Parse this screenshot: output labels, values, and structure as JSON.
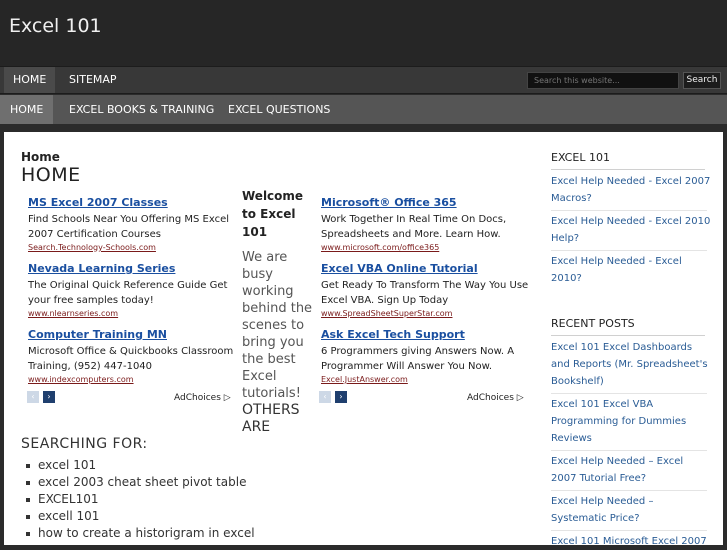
{
  "site": {
    "title": "Excel 101"
  },
  "nav_primary": [
    {
      "label": "HOME"
    },
    {
      "label": "SITEMAP"
    }
  ],
  "search": {
    "placeholder": "Search this website...",
    "button_label": "Search"
  },
  "nav_secondary": [
    {
      "label": "HOME"
    },
    {
      "label": "EXCEL BOOKS & TRAINING"
    },
    {
      "label": "EXCEL QUESTIONS"
    }
  ],
  "main": {
    "breadcrumb": "Home",
    "title": "HOME",
    "welcome_title": "Welcome to Excel 101",
    "welcome_text": "We are busy working behind the scenes to bring you the best Excel tutorials!",
    "others_label": "OTHERS ARE",
    "searching_heading": "SEARCHING FOR:",
    "search_terms": [
      "excel 101",
      "excel 2003 cheat sheet pivot table",
      "EXCEL101",
      "excell 101",
      "how to create a historigram in excel"
    ]
  },
  "ads_left": {
    "items": [
      {
        "title": "MS Excel 2007 Classes",
        "text": "Find Schools Near You Offering MS Excel 2007 Certification Courses",
        "url": "Search.Technology-Schools.com"
      },
      {
        "title": "Nevada Learning Series",
        "text": "The Original Quick Reference Guide Get your free samples today!",
        "url": "www.nlearnseries.com"
      },
      {
        "title": "Computer Training MN",
        "text": "Microsoft Office & Quickbooks Classroom Training, (952) 447-1040",
        "url": "www.indexcomputers.com"
      }
    ],
    "prev": "‹",
    "next": "›",
    "adchoices": "AdChoices ▷"
  },
  "ads_right": {
    "items": [
      {
        "title": "Microsoft® Office 365",
        "text": "Work Together In Real Time On Docs, Spreadsheets and More. Learn How.",
        "url": "www.microsoft.com/office365"
      },
      {
        "title": "Excel VBA Online Tutorial",
        "text": "Get Ready To Transform The Way You Use Excel VBA. Sign Up Today",
        "url": "www.SpreadSheetSuperStar.com"
      },
      {
        "title": "Ask Excel Tech Support",
        "text": "6 Programmers giving Answers Now. A Programmer Will Answer You Now.",
        "url": "Excel.JustAnswer.com"
      }
    ],
    "prev": "‹",
    "next": "›",
    "adchoices": "AdChoices ▷"
  },
  "sidebar": {
    "widget1_title": "EXCEL 101",
    "widget1_links": [
      "Excel Help Needed - Excel 2007 Macros?",
      "Excel Help Needed - Excel 2010 Help?",
      "Excel Help Needed - Excel 2010?"
    ],
    "widget2_title": "RECENT POSTS",
    "widget2_links": [
      "Excel 101 Excel Dashboards and Reports (Mr. Spreadsheet's Bookshelf)",
      "Excel 101 Excel VBA Programming for Dummies Reviews",
      "Excel Help Needed – Excel 2007 Tutorial Free?",
      "Excel Help Needed – Systematic Price?",
      "Excel 101 Microsoft Excel 2007"
    ]
  },
  "colors": {
    "link": "#2a5c95",
    "ad_title": "#1a4fa0",
    "ad_url": "#7a1a1a",
    "header_bg": "#262626"
  }
}
